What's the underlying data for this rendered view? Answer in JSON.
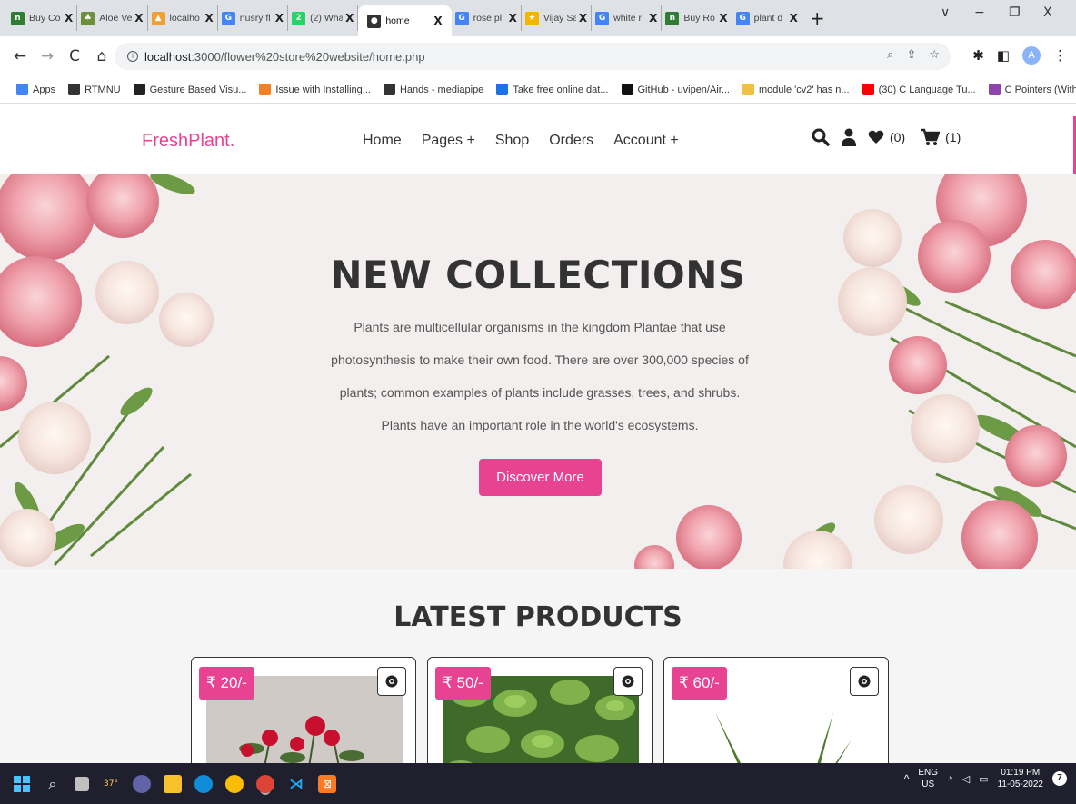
{
  "browser": {
    "tabs": [
      {
        "label": "Buy Co",
        "color": "#2e7d32",
        "glyph": "n"
      },
      {
        "label": "Aloe Ve",
        "color": "#6d8f3a",
        "glyph": "♣"
      },
      {
        "label": "localho",
        "color": "#f0a030",
        "glyph": "▲"
      },
      {
        "label": "nusry fl",
        "color": "#4285f4",
        "glyph": "G"
      },
      {
        "label": "(2) Wha",
        "color": "#25d366",
        "glyph": "2"
      },
      {
        "label": "home",
        "color": "#333333",
        "glyph": "●",
        "active": true
      },
      {
        "label": "rose pl",
        "color": "#4285f4",
        "glyph": "G"
      },
      {
        "label": "Vijay Sa",
        "color": "#f4b400",
        "glyph": "★"
      },
      {
        "label": "white r",
        "color": "#4285f4",
        "glyph": "G"
      },
      {
        "label": "Buy Ro",
        "color": "#2e7d32",
        "glyph": "n"
      },
      {
        "label": "plant d",
        "color": "#4285f4",
        "glyph": "G"
      }
    ],
    "tab_close": "X",
    "new_tab": "+",
    "window_controls": {
      "dropdown": "∨",
      "minimize": "−",
      "maximize": "❐",
      "close": "X"
    },
    "nav": {
      "back": "←",
      "forward": "→",
      "reload": "C",
      "home": "⌂"
    },
    "url_host": "localhost",
    "url_path": ":3000/flower%20store%20website/home.php",
    "profile_initial": "A",
    "bookmarks": [
      {
        "label": "Apps",
        "color": "#4285f4"
      },
      {
        "label": "RTMNU",
        "color": "#333333"
      },
      {
        "label": "Gesture Based Visu...",
        "color": "#222222"
      },
      {
        "label": "Issue with Installing...",
        "color": "#f48024"
      },
      {
        "label": "Hands - mediapipe",
        "color": "#333333"
      },
      {
        "label": "Take free online dat...",
        "color": "#1a73e8"
      },
      {
        "label": "GitHub - uvipen/Air...",
        "color": "#111111"
      },
      {
        "label": "module 'cv2' has n...",
        "color": "#f0c040"
      },
      {
        "label": "(30) C Language Tu...",
        "color": "#ff0000"
      },
      {
        "label": "C Pointers (With Ex...",
        "color": "#8e44ad"
      }
    ],
    "bookmarks_more": "»"
  },
  "site": {
    "logo": "FreshPlant.",
    "nav": [
      "Home",
      "Pages +",
      "Shop",
      "Orders",
      "Account +"
    ],
    "wishlist_count": "(0)",
    "cart_count": "(1)",
    "hero": {
      "title": "NEW COLLECTIONS",
      "text": "Plants are multicellular organisms in the kingdom Plantae that use photosynthesis to make their own food. There are over 300,000 species of plants; common examples of plants include grasses, trees, and shrubs. Plants have an important role in the world's ecosystems.",
      "button": "Discover More"
    },
    "products_title": "LATEST PRODUCTS",
    "products": [
      {
        "price": "₹ 20/-",
        "image": "rose-plant"
      },
      {
        "price": "₹ 50/-",
        "image": "mint-plant"
      },
      {
        "price": "₹ 60/-",
        "image": "aloe-plant"
      }
    ],
    "accent_color": "#e84393"
  },
  "taskbar": {
    "weather": "37°",
    "lang_top": "ENG",
    "lang_bottom": "US",
    "time": "01:19 PM",
    "date": "11-05-2022",
    "notification_count": "7",
    "tray_chevron": "^"
  }
}
